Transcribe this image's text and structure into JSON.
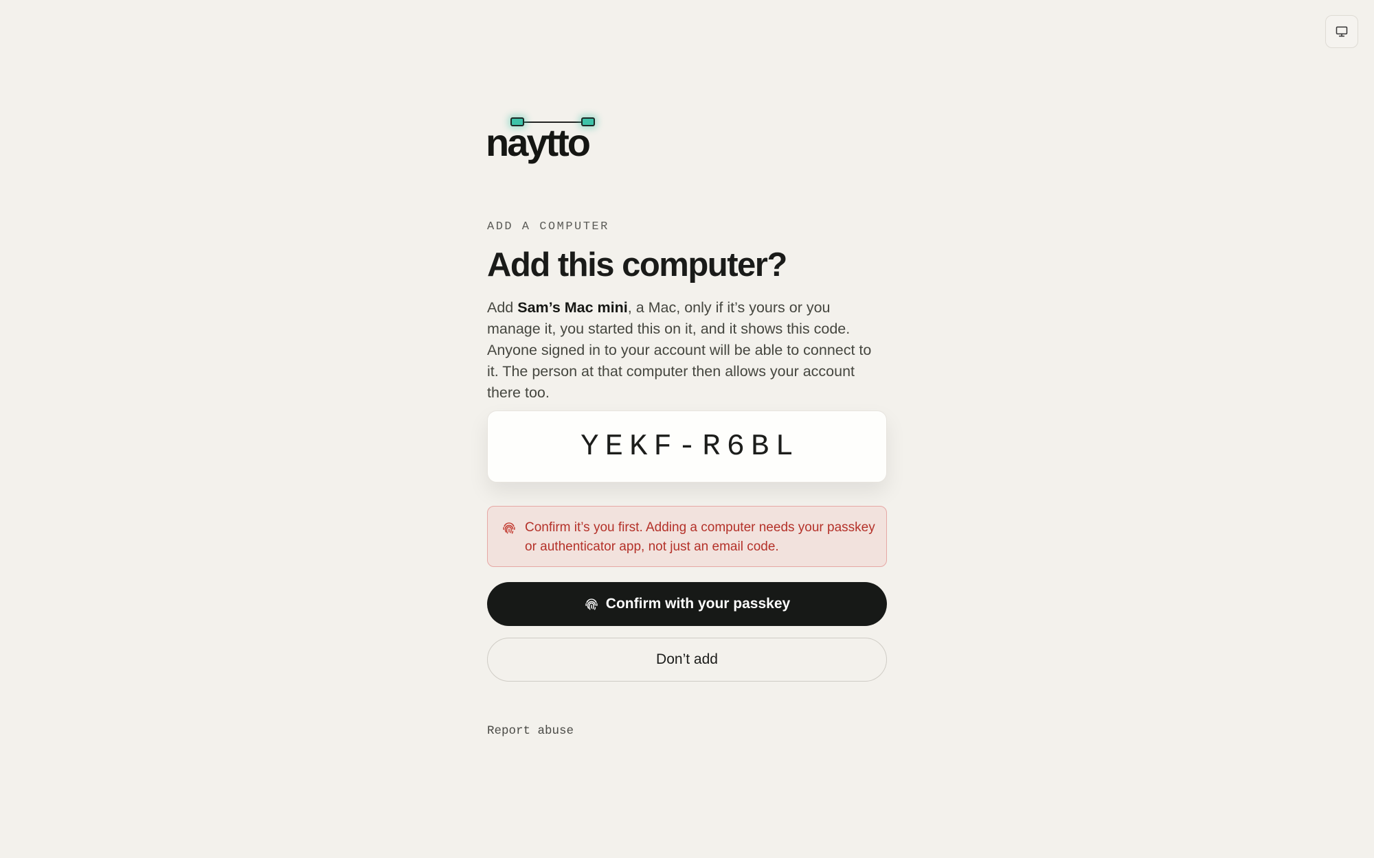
{
  "header": {
    "display_mode_icon": "monitor-icon"
  },
  "brand": {
    "name": "naytto",
    "accent_color": "#3ec3a9"
  },
  "page": {
    "eyebrow": "ADD A COMPUTER",
    "title": "Add this computer?",
    "description": {
      "before": "Add ",
      "device_name": "Sam’s Mac mini",
      "after": ", a Mac, only if it’s yours or you manage it, you started this on it, and it shows this code. Anyone signed in to your account will be able to connect to it. The person at that computer then allows your account there too."
    },
    "code": "YEKF-R6BL"
  },
  "alert": {
    "icon": "fingerprint-icon",
    "text": "Confirm it’s you first. Adding a computer needs your passkey or authenticator app, not just an email code.",
    "color": "#b43129"
  },
  "actions": {
    "confirm_label": "Confirm with your passkey",
    "confirm_icon": "fingerprint-icon",
    "decline_label": "Don’t add"
  },
  "footer": {
    "report_label": "Report abuse"
  }
}
